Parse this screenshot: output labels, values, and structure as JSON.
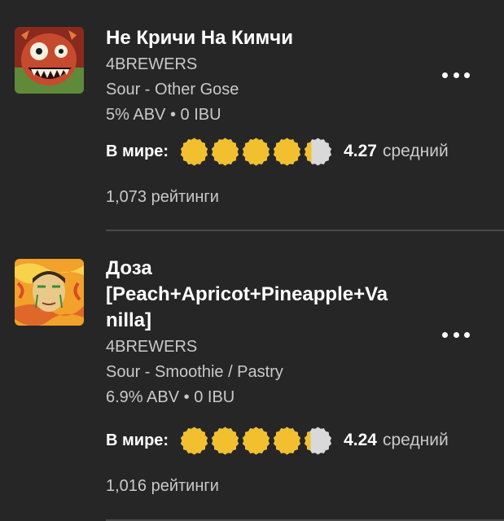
{
  "beers": [
    {
      "name": "Не Кричи На Кимчи",
      "brewery": "4BREWERS",
      "style": "Sour - Other Gose",
      "abv": "5% ABV",
      "separator": "•",
      "ibu": "0 IBU",
      "rating_label": "В мире:",
      "rating_value": 4.27,
      "rating_text": "4.27",
      "rating_word": "средний",
      "ratings_count": "1,073 рейтинги",
      "thumb_icon": "monster-label-icon",
      "more_icon": "more-dots-icon"
    },
    {
      "name": "Доза",
      "name_line2": "[Peach+Apricot+Pineapple+Va",
      "name_line3": "nilla]",
      "brewery": "4BREWERS",
      "style": "Sour - Smoothie / Pastry",
      "abv": "6.9% ABV",
      "separator": "•",
      "ibu": "0 IBU",
      "rating_label": "В мире:",
      "rating_value": 4.24,
      "rating_text": "4.24",
      "rating_word": "средний",
      "ratings_count": "1,016 рейтинги",
      "thumb_icon": "face-label-icon",
      "more_icon": "more-dots-icon"
    }
  ],
  "colors": {
    "background": "#262626",
    "cap_fill": "#f2bf2f",
    "cap_empty": "#d9d9d9",
    "secondary_text": "#c9c9c9",
    "divider": "#4a4a4a"
  }
}
